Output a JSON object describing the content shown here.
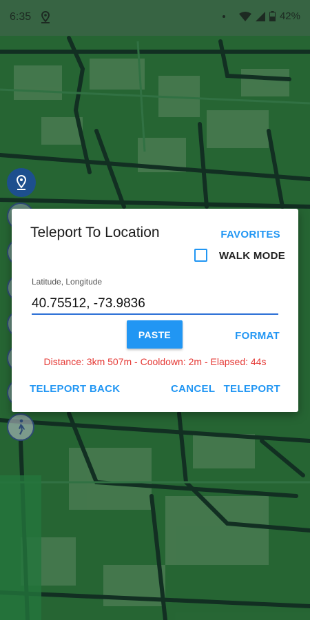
{
  "status_bar": {
    "time": "6:35",
    "battery": "42%",
    "icons": [
      "location-pin-icon",
      "dot-icon",
      "wifi-icon",
      "signal-icon",
      "battery-icon"
    ]
  },
  "map_controls": {
    "icons": [
      "location-marker-icon",
      "walk-person-icon"
    ]
  },
  "dialog": {
    "title": "Teleport To Location",
    "favorites_label": "FAVORITES",
    "walk_mode_label": "WALK MODE",
    "walk_mode_checked": false,
    "coord_label": "Latitude, Longitude",
    "coord_value": "40.75512, -73.9836",
    "paste_label": "PASTE",
    "format_label": "FORMAT",
    "status_text": "Distance: 3km 507m - Cooldown: 2m - Elapsed: 44s",
    "teleport_back_label": "TELEPORT BACK",
    "cancel_label": "CANCEL",
    "teleport_label": "TELEPORT"
  },
  "colors": {
    "accent": "#2196f3",
    "status_red": "#e53935",
    "map_green": "#2e7d3e",
    "road_dark": "#173a2a"
  }
}
